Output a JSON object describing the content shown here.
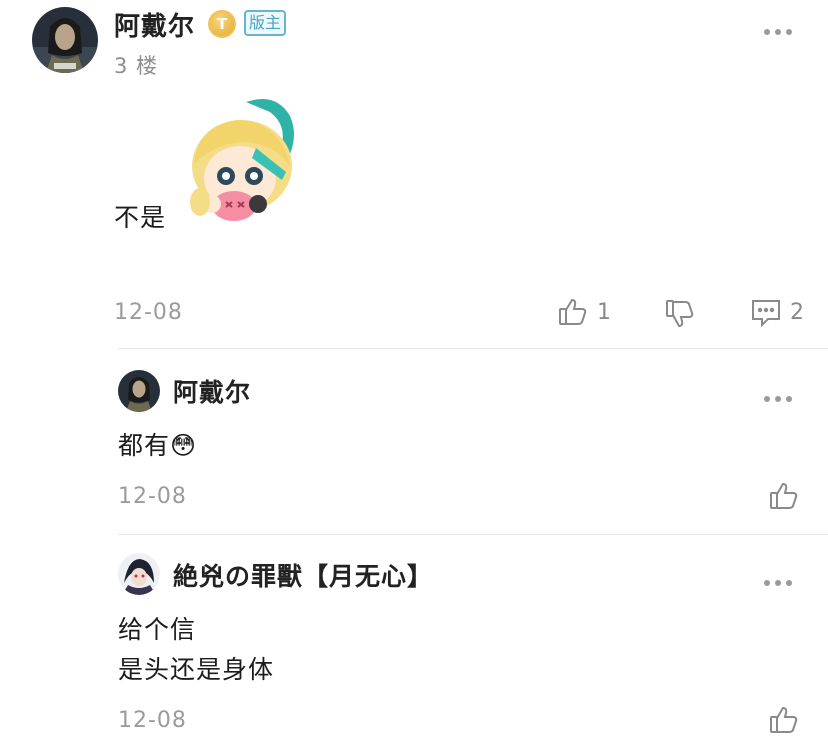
{
  "post": {
    "username": "阿戴尔",
    "coin_badge": "T",
    "mod_badge": "版主",
    "floor": "3 楼",
    "text": "不是",
    "date": "12-08",
    "like_count": "1",
    "comment_count": "2"
  },
  "replies": [
    {
      "username": "阿戴尔",
      "text": "都有😳",
      "date": "12-08"
    },
    {
      "username": "絶兇の罪獸【月无心】",
      "text_line1": "给个信",
      "text_line2": "是头还是身体",
      "date": "12-08"
    }
  ],
  "icons": {
    "like": "thumbs-up-icon",
    "dislike": "thumbs-down-icon",
    "comment": "comment-icon",
    "more": "more-icon"
  },
  "colors": {
    "mod_badge": "#46a6c4",
    "coin_badge": "#e3a832",
    "muted_text": "#9b9b9b"
  }
}
